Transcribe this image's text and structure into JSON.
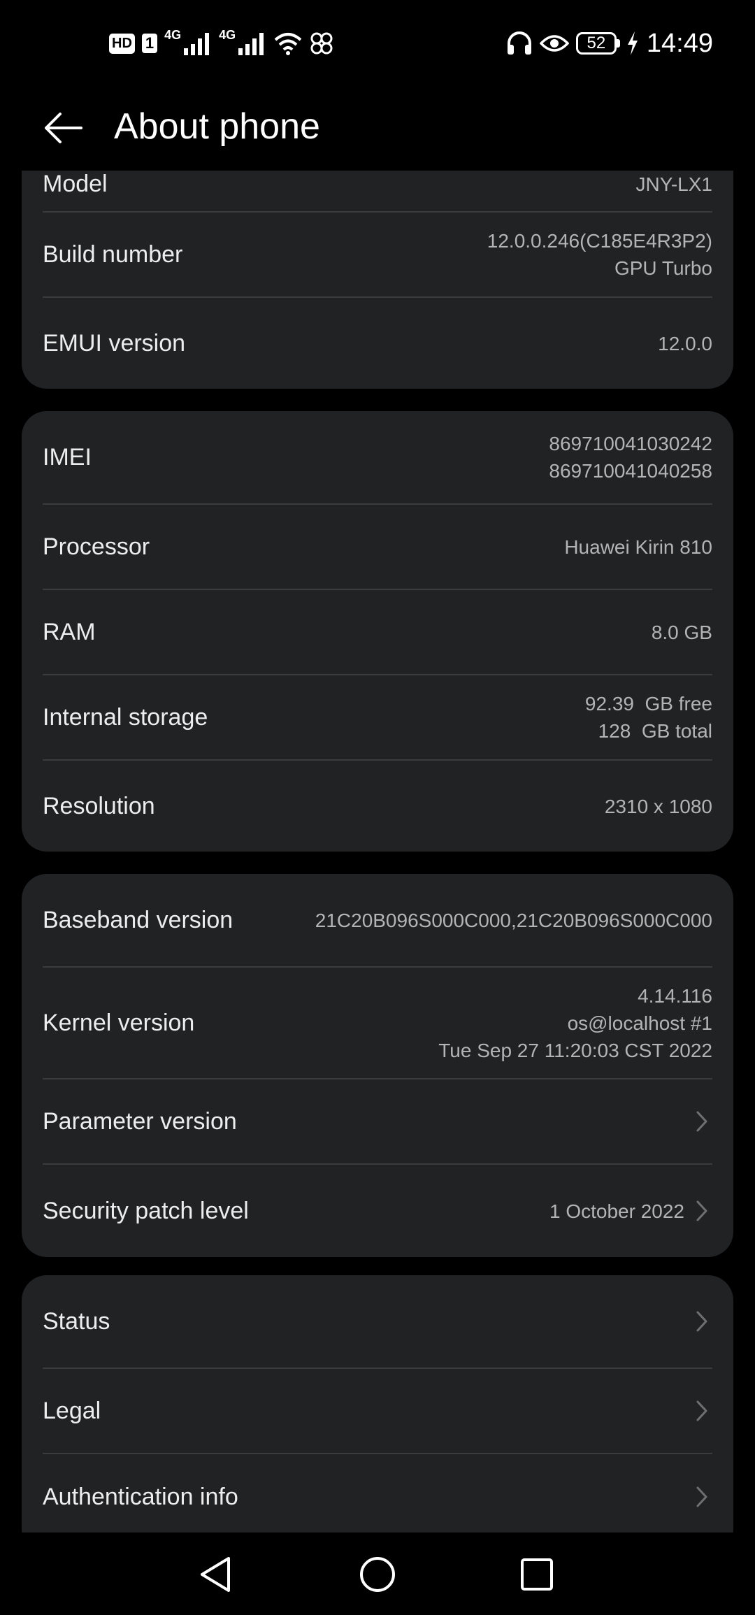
{
  "status_bar": {
    "hd": "HD",
    "sim1": "1",
    "net1": "4G",
    "net2": "4G",
    "battery": "52",
    "time": "14:49",
    "icons": [
      "hd-icon",
      "signal-icon",
      "signal-icon",
      "wifi-icon",
      "pinwheel-icon",
      "headphones-icon",
      "eye-icon",
      "battery-icon",
      "charging-icon"
    ]
  },
  "header": {
    "title": "About phone",
    "back_icon": "arrow-left-icon"
  },
  "cards": [
    {
      "rows": [
        {
          "label": "Model",
          "value": [
            "JNY-LX1"
          ]
        },
        {
          "label": "Build number",
          "value": [
            "12.0.0.246(C185E4R3P2)",
            "GPU Turbo"
          ]
        },
        {
          "label": "EMUI version",
          "value": [
            "12.0.0"
          ]
        }
      ]
    },
    {
      "rows": [
        {
          "label": "IMEI",
          "value": [
            "869710041030242",
            "869710041040258"
          ]
        },
        {
          "label": "Processor",
          "value": [
            "Huawei Kirin 810"
          ]
        },
        {
          "label": "RAM",
          "value": [
            "8.0 GB"
          ]
        },
        {
          "label": "Internal storage",
          "value": [
            "92.39  GB free",
            "128  GB total"
          ]
        },
        {
          "label": "Resolution",
          "value": [
            "2310 x 1080"
          ]
        }
      ]
    },
    {
      "rows": [
        {
          "label": "Baseband version",
          "value": [
            "21C20B096S000C000,21C20B096S000C000"
          ]
        },
        {
          "label": "Kernel version",
          "value": [
            "4.14.116",
            "os@localhost #1",
            "Tue Sep 27 11:20:03 CST 2022"
          ]
        },
        {
          "label": "Parameter version",
          "value": []
        },
        {
          "label": "Security patch level",
          "value": [
            "1 October 2022"
          ]
        }
      ]
    },
    {
      "rows": [
        {
          "label": "Status"
        },
        {
          "label": "Legal"
        },
        {
          "label": "Authentication info"
        }
      ]
    }
  ],
  "nav_bar": {
    "icons": [
      "back-triangle-icon",
      "home-circle-icon",
      "recents-square-icon"
    ]
  },
  "colors": {
    "background": "#000000",
    "card": "#212224",
    "divider": "#3a3b3e",
    "label": "#ededed",
    "value": "#b4b4b4"
  }
}
